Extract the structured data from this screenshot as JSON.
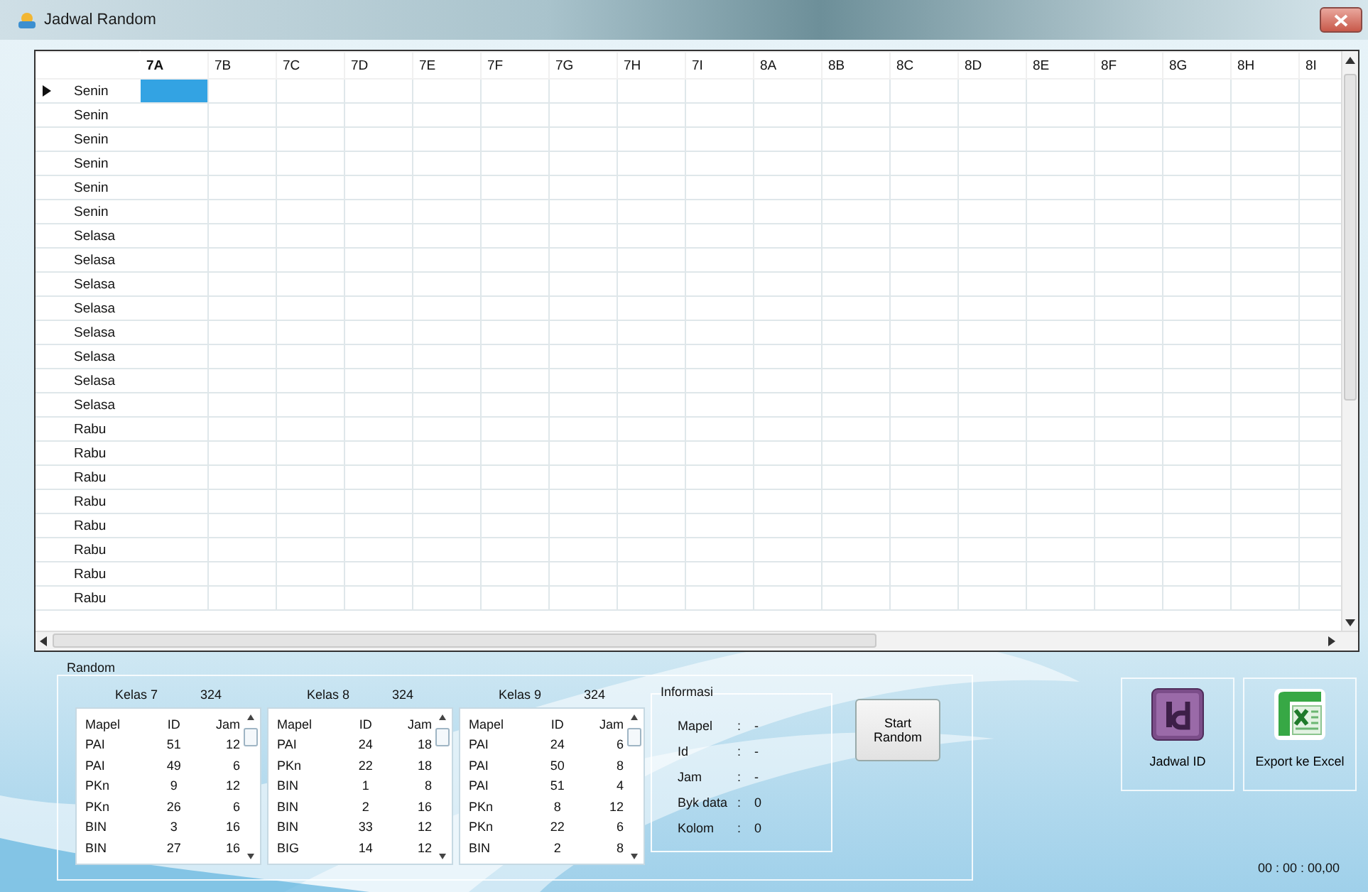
{
  "window": {
    "title": "Jadwal Random"
  },
  "grid": {
    "columns": [
      {
        "label": "7A",
        "selected": true
      },
      {
        "label": "7B",
        "selected": false
      },
      {
        "label": "7C",
        "selected": false
      },
      {
        "label": "7D",
        "selected": false
      },
      {
        "label": "7E",
        "selected": false
      },
      {
        "label": "7F",
        "selected": false
      },
      {
        "label": "7G",
        "selected": false
      },
      {
        "label": "7H",
        "selected": false
      },
      {
        "label": "7I",
        "selected": false
      },
      {
        "label": "8A",
        "selected": false
      },
      {
        "label": "8B",
        "selected": false
      },
      {
        "label": "8C",
        "selected": false
      },
      {
        "label": "8D",
        "selected": false
      },
      {
        "label": "8E",
        "selected": false
      },
      {
        "label": "8F",
        "selected": false
      },
      {
        "label": "8G",
        "selected": false
      },
      {
        "label": "8H",
        "selected": false
      },
      {
        "label": "8I",
        "selected": false
      }
    ],
    "rows": [
      {
        "label": "Senin",
        "current": true
      },
      {
        "label": "Senin",
        "current": false
      },
      {
        "label": "Senin",
        "current": false
      },
      {
        "label": "Senin",
        "current": false
      },
      {
        "label": "Senin",
        "current": false
      },
      {
        "label": "Senin",
        "current": false
      },
      {
        "label": "Selasa",
        "current": false
      },
      {
        "label": "Selasa",
        "current": false
      },
      {
        "label": "Selasa",
        "current": false
      },
      {
        "label": "Selasa",
        "current": false
      },
      {
        "label": "Selasa",
        "current": false
      },
      {
        "label": "Selasa",
        "current": false
      },
      {
        "label": "Selasa",
        "current": false
      },
      {
        "label": "Selasa",
        "current": false
      },
      {
        "label": "Rabu",
        "current": false
      },
      {
        "label": "Rabu",
        "current": false
      },
      {
        "label": "Rabu",
        "current": false
      },
      {
        "label": "Rabu",
        "current": false
      },
      {
        "label": "Rabu",
        "current": false
      },
      {
        "label": "Rabu",
        "current": false
      },
      {
        "label": "Rabu",
        "current": false
      },
      {
        "label": "Rabu",
        "current": false
      }
    ]
  },
  "random": {
    "title": "Random",
    "lists": [
      {
        "class_label": "Kelas 7",
        "total": "324",
        "columns": [
          "Mapel",
          "ID",
          "Jam"
        ],
        "rows": [
          [
            "PAI",
            "51",
            "12"
          ],
          [
            "PAI",
            "49",
            "6"
          ],
          [
            "PKn",
            "9",
            "12"
          ],
          [
            "PKn",
            "26",
            "6"
          ],
          [
            "BIN",
            "3",
            "16"
          ],
          [
            "BIN",
            "27",
            "16"
          ]
        ]
      },
      {
        "class_label": "Kelas 8",
        "total": "324",
        "columns": [
          "Mapel",
          "ID",
          "Jam"
        ],
        "rows": [
          [
            "PAI",
            "24",
            "18"
          ],
          [
            "PKn",
            "22",
            "18"
          ],
          [
            "BIN",
            "1",
            "8"
          ],
          [
            "BIN",
            "2",
            "16"
          ],
          [
            "BIN",
            "33",
            "12"
          ],
          [
            "BIG",
            "14",
            "12"
          ]
        ]
      },
      {
        "class_label": "Kelas 9",
        "total": "324",
        "columns": [
          "Mapel",
          "ID",
          "Jam"
        ],
        "rows": [
          [
            "PAI",
            "24",
            "6"
          ],
          [
            "PAI",
            "50",
            "8"
          ],
          [
            "PAI",
            "51",
            "4"
          ],
          [
            "PKn",
            "8",
            "12"
          ],
          [
            "PKn",
            "22",
            "6"
          ],
          [
            "BIN",
            "2",
            "8"
          ]
        ]
      }
    ],
    "info": {
      "title": "Informasi",
      "fields": [
        {
          "label": "Mapel",
          "separator": ":",
          "value": "-"
        },
        {
          "label": "Id",
          "separator": ":",
          "value": "-"
        },
        {
          "label": "Jam",
          "separator": ":",
          "value": "-"
        },
        {
          "label": "Byk data",
          "separator": ":",
          "value": "0"
        },
        {
          "label": "Kolom",
          "separator": ":",
          "value": "0"
        }
      ]
    },
    "start_button": {
      "label": "Start Random"
    }
  },
  "tools": [
    {
      "label": "Jadwal ID",
      "kind": "indesign"
    },
    {
      "label": "Export ke Excel",
      "kind": "excel"
    }
  ],
  "timer": "00 : 00 : 00,00"
}
